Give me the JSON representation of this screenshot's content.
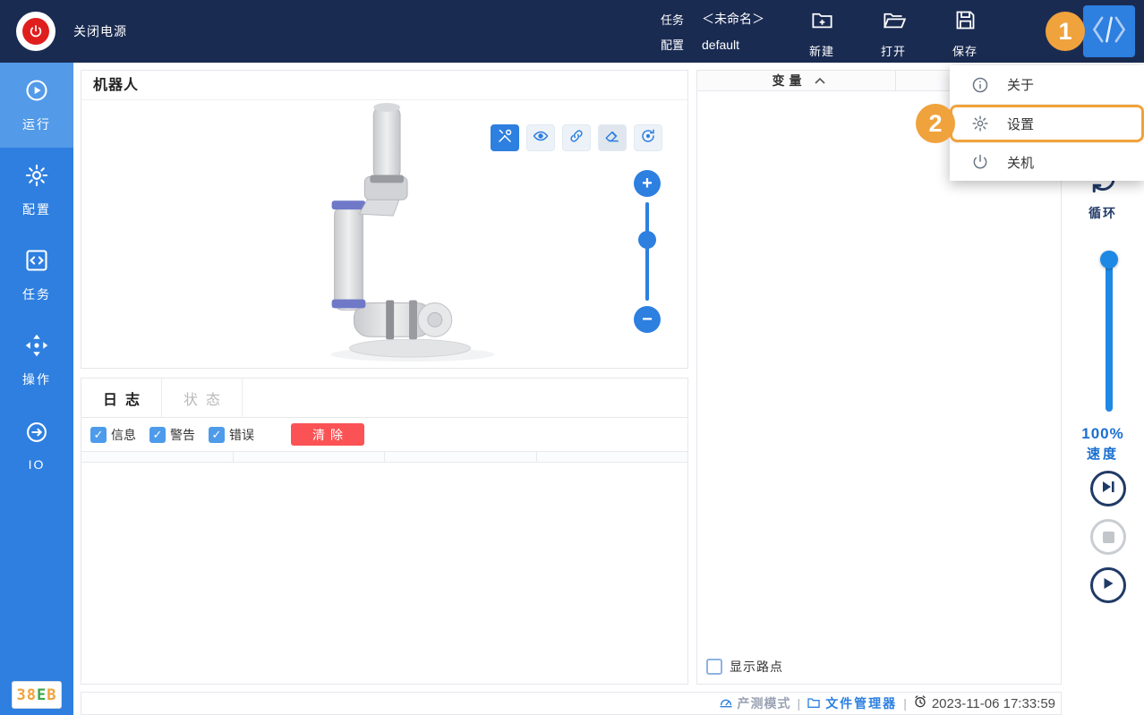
{
  "colors": {
    "topbar_bg": "#1A2B52",
    "sidebar_bg": "#2E7FE0",
    "sidebar_active_bg": "#539AE9",
    "accent_blue": "#2D7FE0",
    "slider_blue": "#1E88E5",
    "speed_text_blue": "#1A6FD0",
    "power_red": "#E01E1E",
    "clear_button_red": "#FB5355",
    "annotation_orange": "#F0A23C",
    "transport_navy": "#203A66"
  },
  "topbar": {
    "power_off_label": "关闭电源",
    "task_label": "任务",
    "task_value": "＜未命名＞",
    "config_label": "配置",
    "config_value": "default",
    "actions": [
      {
        "label": "新建",
        "icon": "new-file-icon"
      },
      {
        "label": "打开",
        "icon": "open-file-icon"
      },
      {
        "label": "保存",
        "icon": "save-icon"
      }
    ]
  },
  "menu": {
    "items": [
      {
        "label": "关于",
        "icon": "info-icon",
        "highlighted": false
      },
      {
        "label": "设置",
        "icon": "gear-icon",
        "highlighted": true
      },
      {
        "label": "关机",
        "icon": "power-icon",
        "highlighted": false
      }
    ]
  },
  "annotations": {
    "step1": "1",
    "step2": "2"
  },
  "sidebar": {
    "items": [
      {
        "label": "运行",
        "icon": "run-icon",
        "active": true
      },
      {
        "label": "配置",
        "icon": "gear-icon",
        "active": false
      },
      {
        "label": "任务",
        "icon": "code-icon",
        "active": false
      },
      {
        "label": "操作",
        "icon": "move-icon",
        "active": false
      },
      {
        "label": "IO",
        "icon": "io-icon",
        "active": false
      }
    ],
    "version_badge": {
      "chars": [
        "3",
        "8",
        "E",
        "B"
      ]
    }
  },
  "robot_panel": {
    "title": "机器人",
    "toolbar_icons": [
      "tools-icon",
      "eye-icon",
      "link-icon",
      "eraser-icon",
      "rotate-icon"
    ],
    "zoom_in": "+",
    "zoom_out": "−"
  },
  "log_panel": {
    "tabs": [
      {
        "label": "日志",
        "active": true
      },
      {
        "label": "状态",
        "active": false
      }
    ],
    "filters": [
      {
        "label": "信息",
        "checked": true
      },
      {
        "label": "警告",
        "checked": true
      },
      {
        "label": "错误",
        "checked": true
      }
    ],
    "clear_label": "清除",
    "columns": [
      "",
      "",
      "",
      ""
    ],
    "rows": []
  },
  "variables_panel": {
    "title": "变量",
    "show_waypoints_label": "显示路点",
    "show_waypoints_checked": false
  },
  "right_controls": {
    "cycle_label": "循环",
    "speed_value": "100%",
    "speed_label": "速度"
  },
  "statusbar": {
    "mode_label": "产测模式",
    "file_manager_label": "文件管理器",
    "timestamp": "2023-11-06 17:33:59",
    "separator": "|"
  }
}
